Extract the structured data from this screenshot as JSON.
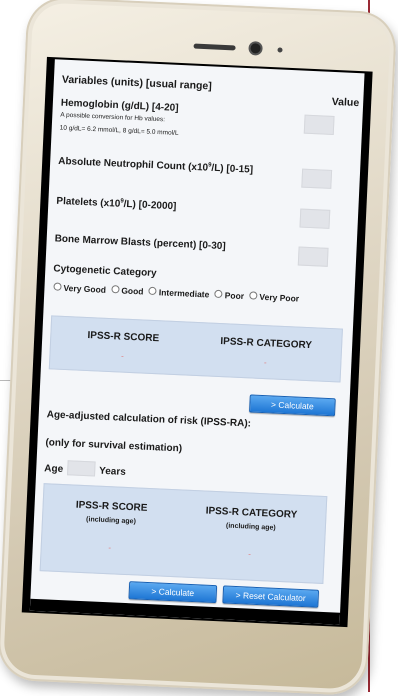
{
  "form": {
    "header_title": "Variables (units) [usual range]",
    "value_header": "Value",
    "hemoglobin": {
      "label": "Hemoglobin (g/dL) [4-20]",
      "note_line1": "A possible conversion for Hb values:",
      "note_line2": "10 g/dL= 6.2 mmol/L, 8 g/dL= 5.0 mmol/L"
    },
    "anc_label_prefix": "Absolute Neutrophil Count (x10",
    "anc_exp": "9",
    "anc_label_suffix": "/L) [0-15]",
    "platelets_label_prefix": "Platelets (x10",
    "platelets_exp": "9",
    "platelets_label_suffix": "/L) [0-2000]",
    "blasts_label": "Bone Marrow Blasts (percent) [0-30]",
    "cytogenetic_label": "Cytogenetic Category",
    "cytogenetic_options": [
      "Very Good",
      "Good",
      "Intermediate",
      "Poor",
      "Very Poor"
    ]
  },
  "result1": {
    "score_header": "IPSS-R SCORE",
    "category_header": "IPSS-R CATEGORY",
    "score_value": "-",
    "category_value": "-"
  },
  "calculate_button": "> Calculate",
  "age_section": {
    "title": "Age-adjusted calculation of risk (IPSS-RA):",
    "subtitle": "(only for survival estimation)",
    "age_label": "Age",
    "years_label": "Years"
  },
  "result2": {
    "score_header": "IPSS-R SCORE",
    "score_sub": "(including age)",
    "category_header": "IPSS-R CATEGORY",
    "category_sub": "(including age)",
    "score_value": "-",
    "category_value": "-"
  },
  "calculate_button2": "> Calculate",
  "reset_button": "> Reset Calculator",
  "colors": {
    "accent": "#1e76d4",
    "result_panel": "#d2dff0",
    "value_box": "#e2e4e9",
    "page_rule": "#9a2a35"
  }
}
